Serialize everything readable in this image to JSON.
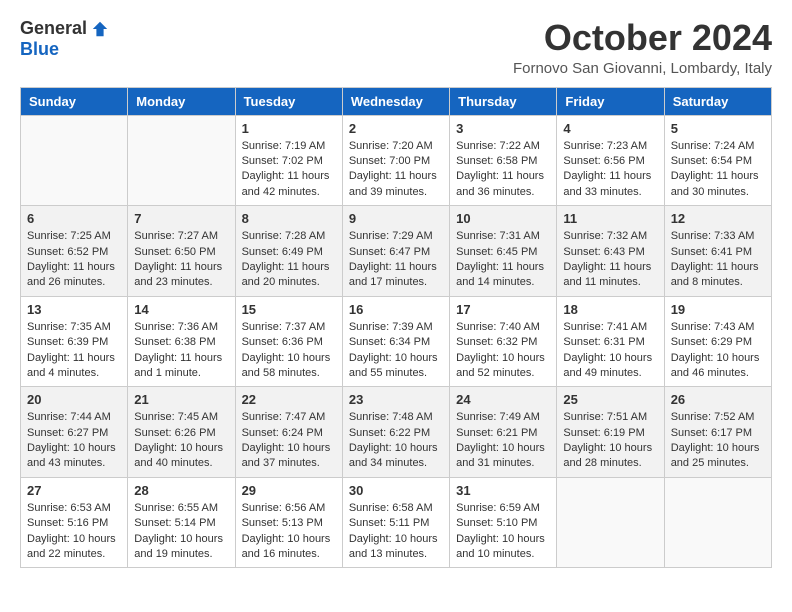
{
  "header": {
    "logo_general": "General",
    "logo_blue": "Blue",
    "month_title": "October 2024",
    "location": "Fornovo San Giovanni, Lombardy, Italy"
  },
  "days_of_week": [
    "Sunday",
    "Monday",
    "Tuesday",
    "Wednesday",
    "Thursday",
    "Friday",
    "Saturday"
  ],
  "weeks": [
    [
      {
        "day": "",
        "content": ""
      },
      {
        "day": "",
        "content": ""
      },
      {
        "day": "1",
        "content": "Sunrise: 7:19 AM\nSunset: 7:02 PM\nDaylight: 11 hours and 42 minutes."
      },
      {
        "day": "2",
        "content": "Sunrise: 7:20 AM\nSunset: 7:00 PM\nDaylight: 11 hours and 39 minutes."
      },
      {
        "day": "3",
        "content": "Sunrise: 7:22 AM\nSunset: 6:58 PM\nDaylight: 11 hours and 36 minutes."
      },
      {
        "day": "4",
        "content": "Sunrise: 7:23 AM\nSunset: 6:56 PM\nDaylight: 11 hours and 33 minutes."
      },
      {
        "day": "5",
        "content": "Sunrise: 7:24 AM\nSunset: 6:54 PM\nDaylight: 11 hours and 30 minutes."
      }
    ],
    [
      {
        "day": "6",
        "content": "Sunrise: 7:25 AM\nSunset: 6:52 PM\nDaylight: 11 hours and 26 minutes."
      },
      {
        "day": "7",
        "content": "Sunrise: 7:27 AM\nSunset: 6:50 PM\nDaylight: 11 hours and 23 minutes."
      },
      {
        "day": "8",
        "content": "Sunrise: 7:28 AM\nSunset: 6:49 PM\nDaylight: 11 hours and 20 minutes."
      },
      {
        "day": "9",
        "content": "Sunrise: 7:29 AM\nSunset: 6:47 PM\nDaylight: 11 hours and 17 minutes."
      },
      {
        "day": "10",
        "content": "Sunrise: 7:31 AM\nSunset: 6:45 PM\nDaylight: 11 hours and 14 minutes."
      },
      {
        "day": "11",
        "content": "Sunrise: 7:32 AM\nSunset: 6:43 PM\nDaylight: 11 hours and 11 minutes."
      },
      {
        "day": "12",
        "content": "Sunrise: 7:33 AM\nSunset: 6:41 PM\nDaylight: 11 hours and 8 minutes."
      }
    ],
    [
      {
        "day": "13",
        "content": "Sunrise: 7:35 AM\nSunset: 6:39 PM\nDaylight: 11 hours and 4 minutes."
      },
      {
        "day": "14",
        "content": "Sunrise: 7:36 AM\nSunset: 6:38 PM\nDaylight: 11 hours and 1 minute."
      },
      {
        "day": "15",
        "content": "Sunrise: 7:37 AM\nSunset: 6:36 PM\nDaylight: 10 hours and 58 minutes."
      },
      {
        "day": "16",
        "content": "Sunrise: 7:39 AM\nSunset: 6:34 PM\nDaylight: 10 hours and 55 minutes."
      },
      {
        "day": "17",
        "content": "Sunrise: 7:40 AM\nSunset: 6:32 PM\nDaylight: 10 hours and 52 minutes."
      },
      {
        "day": "18",
        "content": "Sunrise: 7:41 AM\nSunset: 6:31 PM\nDaylight: 10 hours and 49 minutes."
      },
      {
        "day": "19",
        "content": "Sunrise: 7:43 AM\nSunset: 6:29 PM\nDaylight: 10 hours and 46 minutes."
      }
    ],
    [
      {
        "day": "20",
        "content": "Sunrise: 7:44 AM\nSunset: 6:27 PM\nDaylight: 10 hours and 43 minutes."
      },
      {
        "day": "21",
        "content": "Sunrise: 7:45 AM\nSunset: 6:26 PM\nDaylight: 10 hours and 40 minutes."
      },
      {
        "day": "22",
        "content": "Sunrise: 7:47 AM\nSunset: 6:24 PM\nDaylight: 10 hours and 37 minutes."
      },
      {
        "day": "23",
        "content": "Sunrise: 7:48 AM\nSunset: 6:22 PM\nDaylight: 10 hours and 34 minutes."
      },
      {
        "day": "24",
        "content": "Sunrise: 7:49 AM\nSunset: 6:21 PM\nDaylight: 10 hours and 31 minutes."
      },
      {
        "day": "25",
        "content": "Sunrise: 7:51 AM\nSunset: 6:19 PM\nDaylight: 10 hours and 28 minutes."
      },
      {
        "day": "26",
        "content": "Sunrise: 7:52 AM\nSunset: 6:17 PM\nDaylight: 10 hours and 25 minutes."
      }
    ],
    [
      {
        "day": "27",
        "content": "Sunrise: 6:53 AM\nSunset: 5:16 PM\nDaylight: 10 hours and 22 minutes."
      },
      {
        "day": "28",
        "content": "Sunrise: 6:55 AM\nSunset: 5:14 PM\nDaylight: 10 hours and 19 minutes."
      },
      {
        "day": "29",
        "content": "Sunrise: 6:56 AM\nSunset: 5:13 PM\nDaylight: 10 hours and 16 minutes."
      },
      {
        "day": "30",
        "content": "Sunrise: 6:58 AM\nSunset: 5:11 PM\nDaylight: 10 hours and 13 minutes."
      },
      {
        "day": "31",
        "content": "Sunrise: 6:59 AM\nSunset: 5:10 PM\nDaylight: 10 hours and 10 minutes."
      },
      {
        "day": "",
        "content": ""
      },
      {
        "day": "",
        "content": ""
      }
    ]
  ]
}
